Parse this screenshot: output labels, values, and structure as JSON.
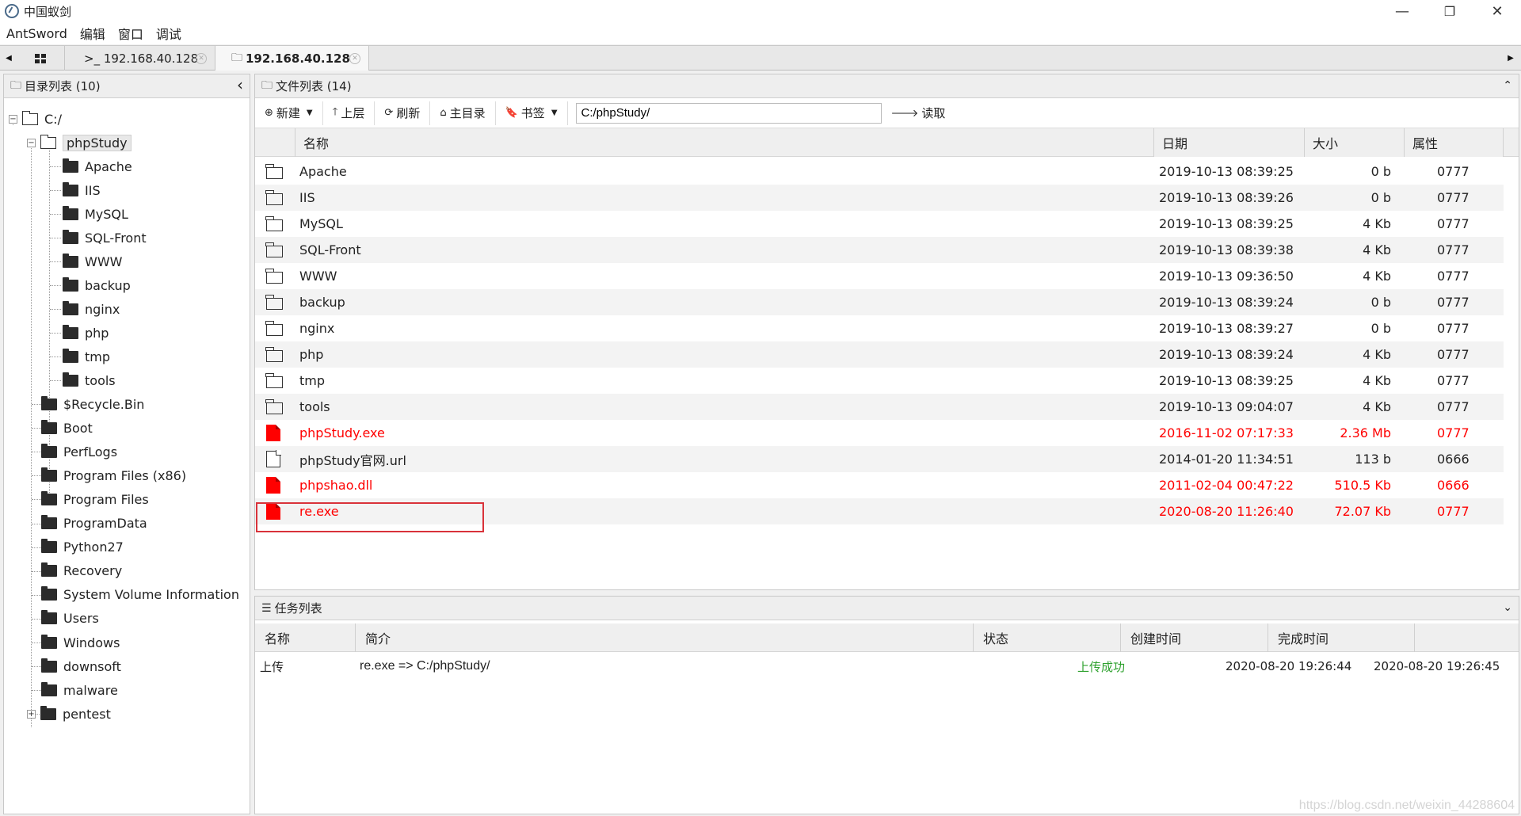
{
  "window": {
    "title": "中国蚁剑",
    "minimize": "—",
    "restore": "❐",
    "close": "✕"
  },
  "menu": [
    "AntSword",
    "编辑",
    "窗口",
    "调试"
  ],
  "tabs": {
    "home_icon": "grid-icon",
    "terminal_tab": ">_ 192.168.40.128",
    "files_tab": "192.168.40.128",
    "scroll_left": "◀",
    "scroll_right": "▶"
  },
  "dir_panel": {
    "title": "目录列表 (10)",
    "collapse_icon": "‹",
    "root": "C:/",
    "open_folder": "phpStudy",
    "php_children": [
      "Apache",
      "IIS",
      "MySQL",
      "SQL-Front",
      "WWW",
      "backup",
      "nginx",
      "php",
      "tmp",
      "tools"
    ],
    "root_children": [
      "$Recycle.Bin",
      "Boot",
      "PerfLogs",
      "Program Files (x86)",
      "Program Files",
      "ProgramData",
      "Python27",
      "Recovery",
      "System Volume Information",
      "Users",
      "Windows",
      "downsoft",
      "malware",
      "pentest"
    ]
  },
  "file_panel": {
    "title": "文件列表 (14)",
    "toolbar": {
      "new": "新建",
      "up": "上层",
      "refresh": "刷新",
      "home": "主目录",
      "bookmark": "书签",
      "path": "C:/phpStudy/",
      "read": "读取"
    },
    "columns": [
      "名称",
      "日期",
      "大小",
      "属性"
    ],
    "rows": [
      {
        "name": "Apache",
        "date": "2019-10-13 08:39:25",
        "size": "0 b",
        "attr": "0777",
        "type": "folder"
      },
      {
        "name": "IIS",
        "date": "2019-10-13 08:39:26",
        "size": "0 b",
        "attr": "0777",
        "type": "folder"
      },
      {
        "name": "MySQL",
        "date": "2019-10-13 08:39:25",
        "size": "4 Kb",
        "attr": "0777",
        "type": "folder"
      },
      {
        "name": "SQL-Front",
        "date": "2019-10-13 08:39:38",
        "size": "4 Kb",
        "attr": "0777",
        "type": "folder"
      },
      {
        "name": "WWW",
        "date": "2019-10-13 09:36:50",
        "size": "4 Kb",
        "attr": "0777",
        "type": "folder"
      },
      {
        "name": "backup",
        "date": "2019-10-13 08:39:24",
        "size": "0 b",
        "attr": "0777",
        "type": "folder"
      },
      {
        "name": "nginx",
        "date": "2019-10-13 08:39:27",
        "size": "0 b",
        "attr": "0777",
        "type": "folder"
      },
      {
        "name": "php",
        "date": "2019-10-13 08:39:24",
        "size": "4 Kb",
        "attr": "0777",
        "type": "folder"
      },
      {
        "name": "tmp",
        "date": "2019-10-13 08:39:25",
        "size": "4 Kb",
        "attr": "0777",
        "type": "folder"
      },
      {
        "name": "tools",
        "date": "2019-10-13 09:04:07",
        "size": "4 Kb",
        "attr": "0777",
        "type": "folder"
      },
      {
        "name": "phpStudy.exe",
        "date": "2016-11-02 07:17:33",
        "size": "2.36 Mb",
        "attr": "0777",
        "type": "binary"
      },
      {
        "name": "phpStudy官网.url",
        "date": "2014-01-20 11:34:51",
        "size": "113 b",
        "attr": "0666",
        "type": "file"
      },
      {
        "name": "phpshao.dll",
        "date": "2011-02-04 00:47:22",
        "size": "510.5 Kb",
        "attr": "0666",
        "type": "binary"
      },
      {
        "name": "re.exe",
        "date": "2020-08-20 11:26:40",
        "size": "72.07 Kb",
        "attr": "0777",
        "type": "binary"
      }
    ]
  },
  "task_panel": {
    "title": "任务列表",
    "columns": [
      "名称",
      "简介",
      "状态",
      "创建时间",
      "完成时间"
    ],
    "rows": [
      {
        "name": "上传",
        "desc": "re.exe => C:/phpStudy/",
        "status": "上传成功",
        "created": "2020-08-20 19:26:44",
        "finished": "2020-08-20 19:26:45"
      }
    ]
  },
  "watermark": "https://blog.csdn.net/weixin_44288604",
  "colors": {
    "danger": "#ff0000",
    "success": "#2ea12e",
    "highlight_box": "#d9323a"
  }
}
